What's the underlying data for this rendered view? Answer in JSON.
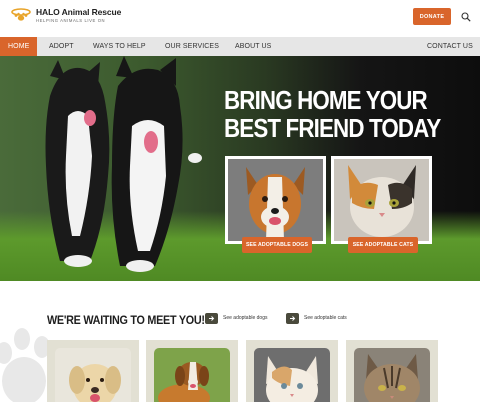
{
  "header": {
    "brand_name": "HALO Animal Rescue",
    "tagline": "HELPING ANIMALS LIVE ON",
    "donate_label": "DONATE",
    "accent_color": "#d9652b"
  },
  "nav": {
    "items": [
      {
        "label": "HOME",
        "active": true
      },
      {
        "label": "ADOPT"
      },
      {
        "label": "WAYS TO HELP"
      },
      {
        "label": "OUR SERVICES"
      },
      {
        "label": "ABOUT US"
      },
      {
        "label": "CONTACT US"
      }
    ]
  },
  "hero": {
    "title_line1": "BRING HOME YOUR",
    "title_line2": "BEST FRIEND TODAY",
    "dogs_button": "SEE ADOPTABLE DOGS",
    "cats_button": "SEE ADOPTABLE CATS"
  },
  "waiting": {
    "title": "WE'RE WAITING TO MEET YOU!",
    "dogs_link": "See adoptable dogs",
    "cats_link": "See adoptable cats"
  },
  "icons": [
    "halo-logo-icon",
    "search-icon",
    "arrow-right-icon",
    "paw-icon"
  ]
}
